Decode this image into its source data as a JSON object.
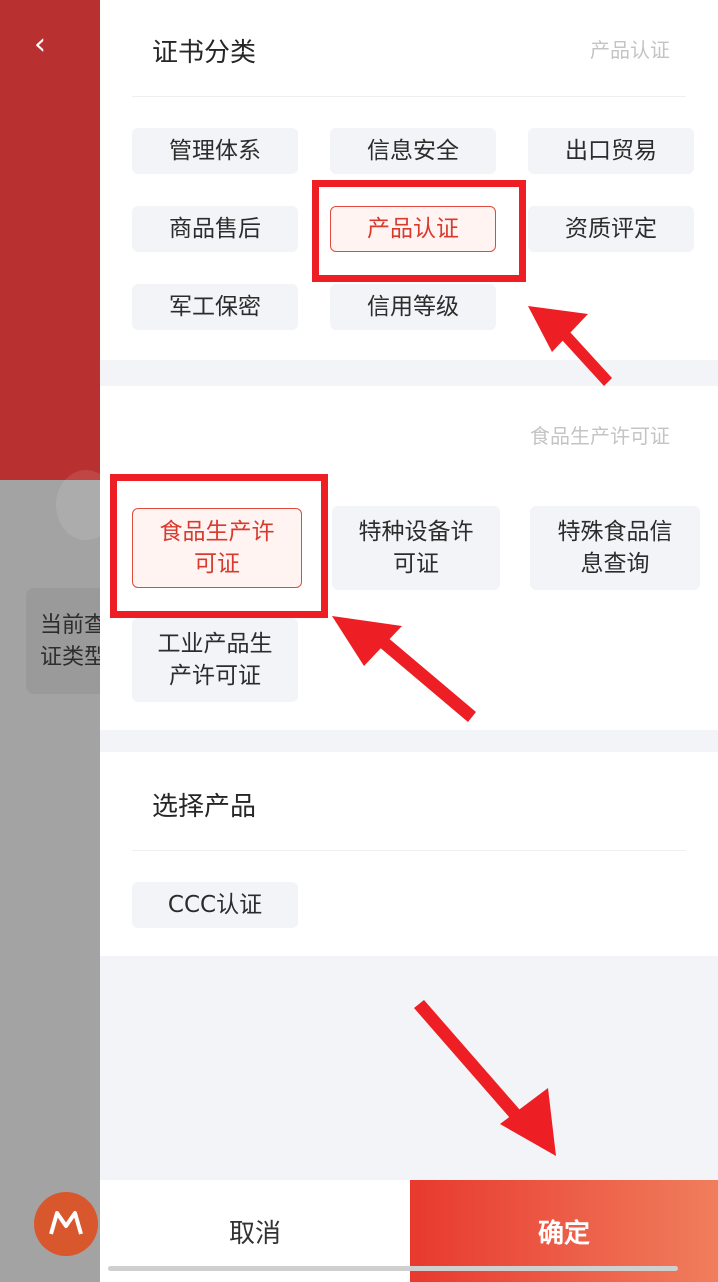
{
  "background": {
    "card_line1": "当前查",
    "card_line2": "证类型"
  },
  "drawer": {
    "category_section": {
      "title": "证书分类",
      "selected_hint": "产品认证",
      "options": [
        "管理体系",
        "信息安全",
        "出口贸易",
        "商品售后",
        "产品认证",
        "资质评定",
        "军工保密",
        "信用等级"
      ],
      "selected": "产品认证"
    },
    "subtype_section": {
      "selected_hint": "食品生产许可证",
      "options": [
        {
          "line1": "食品生产许",
          "line2": "可证"
        },
        {
          "line1": "特种设备许",
          "line2": "可证"
        },
        {
          "line1": "特殊食品信",
          "line2": "息查询"
        },
        {
          "line1": "工业产品生",
          "line2": "产许可证"
        }
      ],
      "selected": "食品生产许可证"
    },
    "product_section": {
      "title": "选择产品",
      "options": [
        "CCC认证"
      ]
    },
    "footer": {
      "cancel_label": "取消",
      "confirm_label": "确定"
    }
  },
  "colors": {
    "accent": "#e04a3c",
    "confirm_gradient_start": "#e8392e",
    "confirm_gradient_end": "#f07e5d",
    "annotation": "#ee1f24",
    "background_header": "#b93030"
  },
  "icons": {
    "back": "chevron-left-icon",
    "logo": "app-logo-icon"
  }
}
